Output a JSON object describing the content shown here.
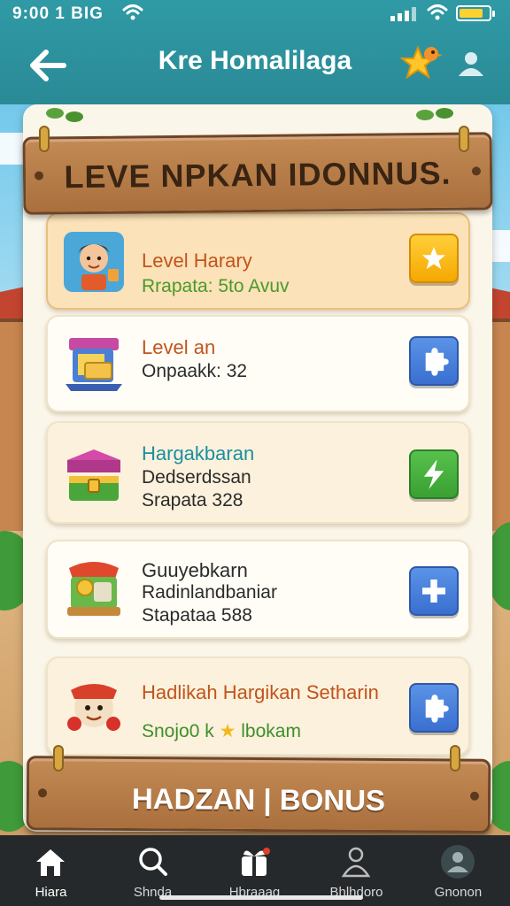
{
  "status_bar": {
    "time": "9:00 1 BIG"
  },
  "header": {
    "title": "Kre Homalilaga"
  },
  "banner": {
    "title": "LEVE NPKAN IDONNUS."
  },
  "cards": [
    {
      "title": "Level Harary",
      "lines": [
        "Rrapata: 5to Avuv"
      ],
      "title_color": "#c0541c",
      "sub_color": "#4a9a2a",
      "button": "star",
      "icon": "character-avatar-icon"
    },
    {
      "title": "Level an",
      "lines": [
        "Onpaakk: 32"
      ],
      "title_color": "#c0541c",
      "sub_color": "#2b2b2b",
      "button": "puzzle",
      "icon": "board-game-icon"
    },
    {
      "title": "Hargakbaran",
      "lines": [
        "Dedserdssan",
        "Srapata 328"
      ],
      "title_color": "#1b8fa0",
      "sub_color": "#2b2b2b",
      "button": "lightning",
      "icon": "treasure-chest-icon"
    },
    {
      "title": "Guuyebkarn",
      "lines": [
        "Radinlandbaniar",
        "Stapataa 588"
      ],
      "title_color": "#2b2b2b",
      "sub_color": "#2b2b2b",
      "button": "cross",
      "icon": "prize-box-icon"
    },
    {
      "title": "Hadlikah Hargikan Setharin",
      "lines": [
        "Snojo0 k",
        "lbokam"
      ],
      "title_color": "#c0541c",
      "sub_color": "#3e8f2c",
      "button": "puzzle",
      "icon": "mascot-badge-icon"
    }
  ],
  "bottom_banner": {
    "label": "HADZAN | BONUS"
  },
  "nav": [
    {
      "label": "Hiara",
      "icon": "home-icon",
      "active": true
    },
    {
      "label": "Shnda",
      "icon": "search-icon",
      "active": false
    },
    {
      "label": "Hbraaag",
      "icon": "gift-icon",
      "active": false
    },
    {
      "label": "Bhlhdoro",
      "icon": "person-icon",
      "active": false
    },
    {
      "label": "Gnonon",
      "icon": "profile-icon",
      "active": false
    }
  ],
  "colors": {
    "header": "#2a8a96",
    "plank": "#b57a45",
    "nav_bg": "#26292b"
  }
}
